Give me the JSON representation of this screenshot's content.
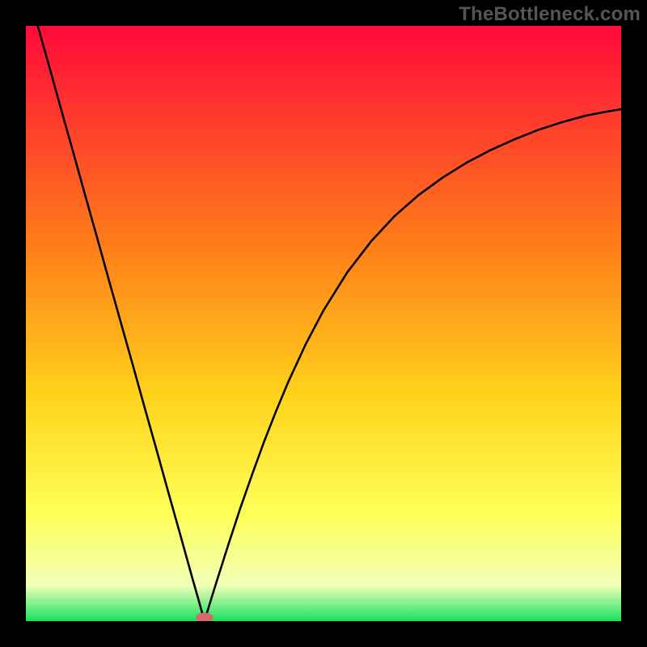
{
  "watermark": "TheBottleneck.com",
  "chart_data": {
    "type": "line",
    "title": "",
    "xlabel": "",
    "ylabel": "",
    "xlim": [
      0,
      100
    ],
    "ylim": [
      0,
      100
    ],
    "grid": false,
    "legend": false,
    "background_gradient": {
      "top_color": "#ff0a3a",
      "mid1_color": "#ff7a1a",
      "mid2_color": "#ffd21a",
      "mid3_color": "#ffff57",
      "low_color": "#f2ffb8",
      "bottom_color": "#18e060"
    },
    "curve": {
      "minimum_x": 30,
      "minimum_y": 0,
      "left_branch_x0": 2,
      "left_branch_y0": 100,
      "right_end_x": 100,
      "right_end_y": 86,
      "x": [
        2,
        4,
        6,
        8,
        10,
        12,
        14,
        16,
        18,
        20,
        22,
        24,
        26,
        28,
        29,
        30,
        31,
        32,
        34,
        36,
        38,
        40,
        42,
        44,
        47,
        50,
        54,
        58,
        62,
        66,
        70,
        74,
        78,
        82,
        86,
        90,
        94,
        97,
        100
      ],
      "y": [
        100,
        92.9,
        85.7,
        78.6,
        71.4,
        64.3,
        57.1,
        50.0,
        42.9,
        35.7,
        28.6,
        21.4,
        14.3,
        7.1,
        3.6,
        0,
        3.3,
        6.5,
        12.8,
        18.9,
        24.6,
        30.1,
        35.2,
        40.0,
        46.5,
        52.2,
        58.6,
        63.8,
        68.1,
        71.6,
        74.5,
        77.0,
        79.1,
        80.9,
        82.5,
        83.8,
        84.9,
        85.5,
        86.0
      ]
    },
    "marker": {
      "x": 30,
      "y": 0,
      "color": "#d46a6a",
      "rx": 11,
      "ry": 6
    }
  }
}
